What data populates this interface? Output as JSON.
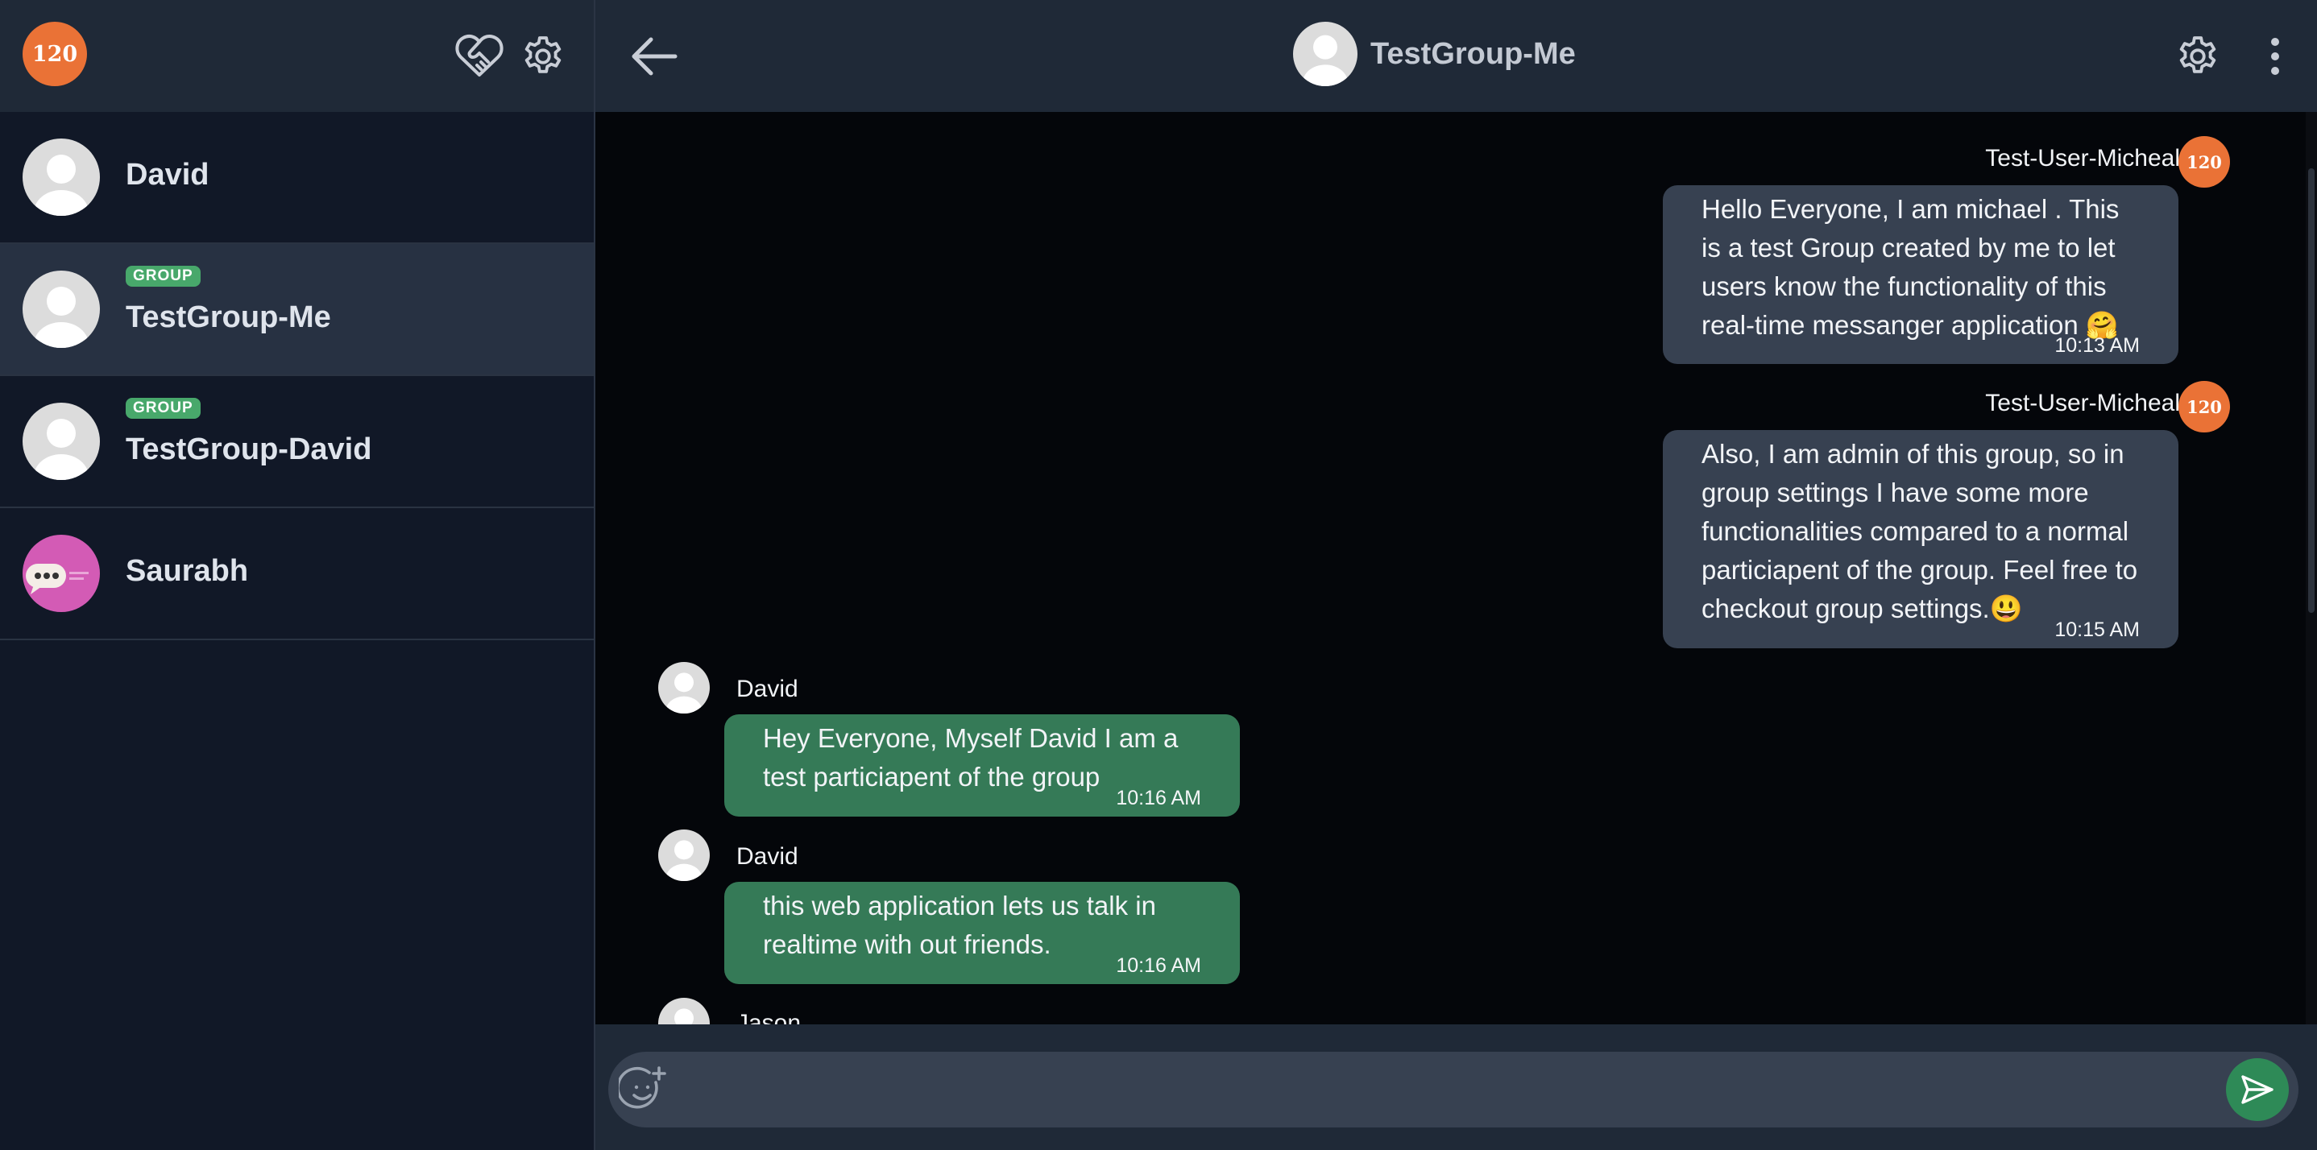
{
  "app": {
    "logo_text": "120"
  },
  "sidebar": {
    "chats": [
      {
        "name": "David",
        "is_group": false,
        "group_badge": "",
        "avatar": "default-avatar"
      },
      {
        "name": "TestGroup-Me",
        "is_group": true,
        "group_badge": "GROUP",
        "avatar": "default-avatar",
        "active": true
      },
      {
        "name": "TestGroup-David",
        "is_group": true,
        "group_badge": "GROUP",
        "avatar": "default-avatar"
      },
      {
        "name": "Saurabh",
        "is_group": false,
        "group_badge": "",
        "avatar": "chat-bubble-avatar"
      }
    ]
  },
  "header": {
    "title": "TestGroup-Me"
  },
  "messages": [
    {
      "sender": "Test-User-Micheal",
      "own": true,
      "text": "Hello Everyone, I am michael . This is a test Group created by me to let users know the functionality of this real-time messanger application 🤗",
      "time": "10:13 AM"
    },
    {
      "sender": "Test-User-Micheal",
      "own": true,
      "text": "Also, I am admin of this group, so in group settings I have some more functionalities compared to a normal particiapent of the group. Feel free to checkout group settings.😃",
      "time": "10:15 AM"
    },
    {
      "sender": "David",
      "own": false,
      "text": "Hey Everyone, Myself David I am a test particiapent of the group",
      "time": "10:16 AM"
    },
    {
      "sender": "David",
      "own": false,
      "text": "this web application lets us talk in realtime with out friends.",
      "time": "10:16 AM"
    },
    {
      "sender": "Jason",
      "own": false,
      "text": "",
      "time": ""
    }
  ],
  "composer": {
    "placeholder": ""
  },
  "colors": {
    "accent_orange": "#ea7236",
    "group_badge": "#48a86b",
    "own_bubble": "#374151",
    "other_bubble": "#357a57",
    "send_button": "#2e8a57"
  },
  "icons": [
    "heart-handshake-icon",
    "gear-icon",
    "back-arrow-icon",
    "kebab-menu-icon",
    "emoji-add-icon",
    "send-icon"
  ]
}
